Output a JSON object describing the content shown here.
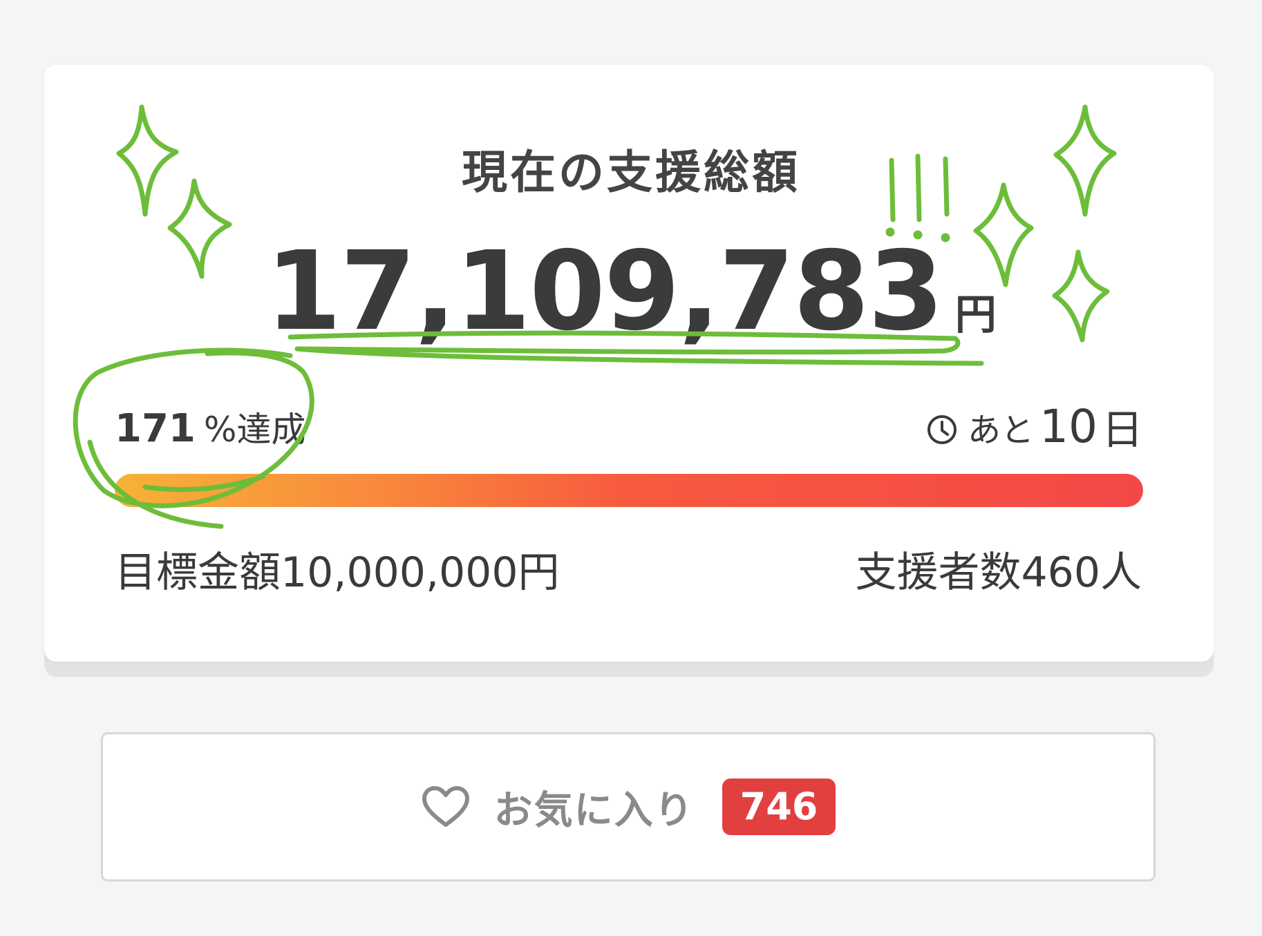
{
  "card": {
    "title": "現在の支援総額",
    "amount": "17,109,783",
    "amount_unit": "円",
    "achievement_percent": "171",
    "achievement_label": "%達成",
    "remaining_prefix": "あと",
    "remaining_days": "10",
    "remaining_unit": "日",
    "progress_percent": 100,
    "goal_text": "目標金額10,000,000円",
    "supporters_text": "支援者数460人"
  },
  "favorite": {
    "label": "お気に入り",
    "count": "746"
  },
  "icons": {
    "clock": "clock-icon",
    "heart": "heart-icon"
  },
  "colors": {
    "accent_green": "#6dbd3a",
    "badge_red": "#e2403f",
    "progress_start": "#f7b238",
    "progress_end": "#f44848"
  }
}
